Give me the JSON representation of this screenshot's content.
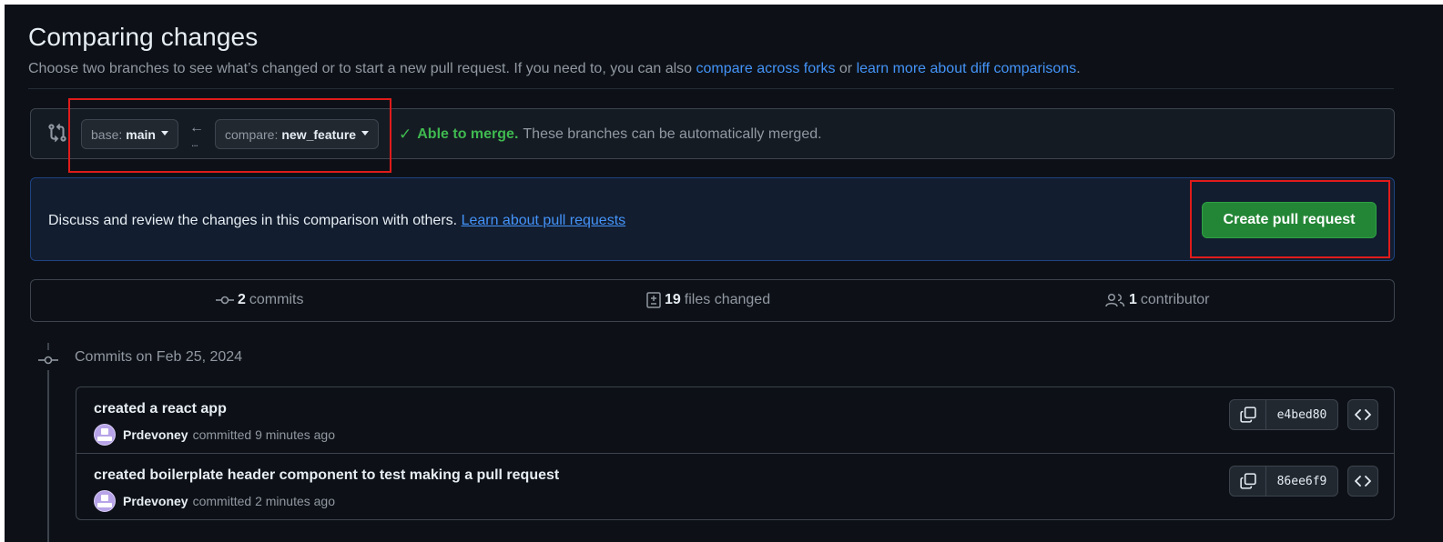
{
  "header": {
    "title": "Comparing changes",
    "intro_text": "Choose two branches to see what’s changed or to start a new pull request. If you need to, you can also",
    "link_forks": "compare across forks",
    "or_text": "or",
    "link_diff": "learn more about diff comparisons",
    "period": "."
  },
  "range": {
    "base_prefix": "base:",
    "base_branch": "main",
    "compare_prefix": "compare:",
    "compare_branch": "new_feature",
    "merge_status": "Able to merge.",
    "merge_detail": "These branches can be automatically merged."
  },
  "flash": {
    "text": "Discuss and review the changes in this comparison with others.",
    "link": "Learn about pull requests",
    "create_button": "Create pull request"
  },
  "summary": {
    "commits_count": "2",
    "commits_label": "commits",
    "files_count": "19",
    "files_label": "files changed",
    "contributors_count": "1",
    "contributors_label": "contributor"
  },
  "timeline": {
    "heading": "Commits on Feb 25, 2024",
    "commits": [
      {
        "title": "created a react app",
        "author": "Prdevoney",
        "verb": "committed",
        "time": "9 minutes ago",
        "sha": "e4bed80"
      },
      {
        "title": "created boilerplate header component to test making a pull request",
        "author": "Prdevoney",
        "verb": "committed",
        "time": "2 minutes ago",
        "sha": "86ee6f9"
      }
    ]
  },
  "colors": {
    "background": "#0d1117",
    "accent_link": "#4493f8",
    "success": "#3fb950",
    "primary_button": "#238636",
    "annotation_red": "#e01b1b"
  },
  "icons": [
    "git-compare-icon",
    "arrow-left-icon",
    "check-icon",
    "git-commit-icon",
    "file-diff-icon",
    "people-icon",
    "copy-icon",
    "code-icon"
  ]
}
